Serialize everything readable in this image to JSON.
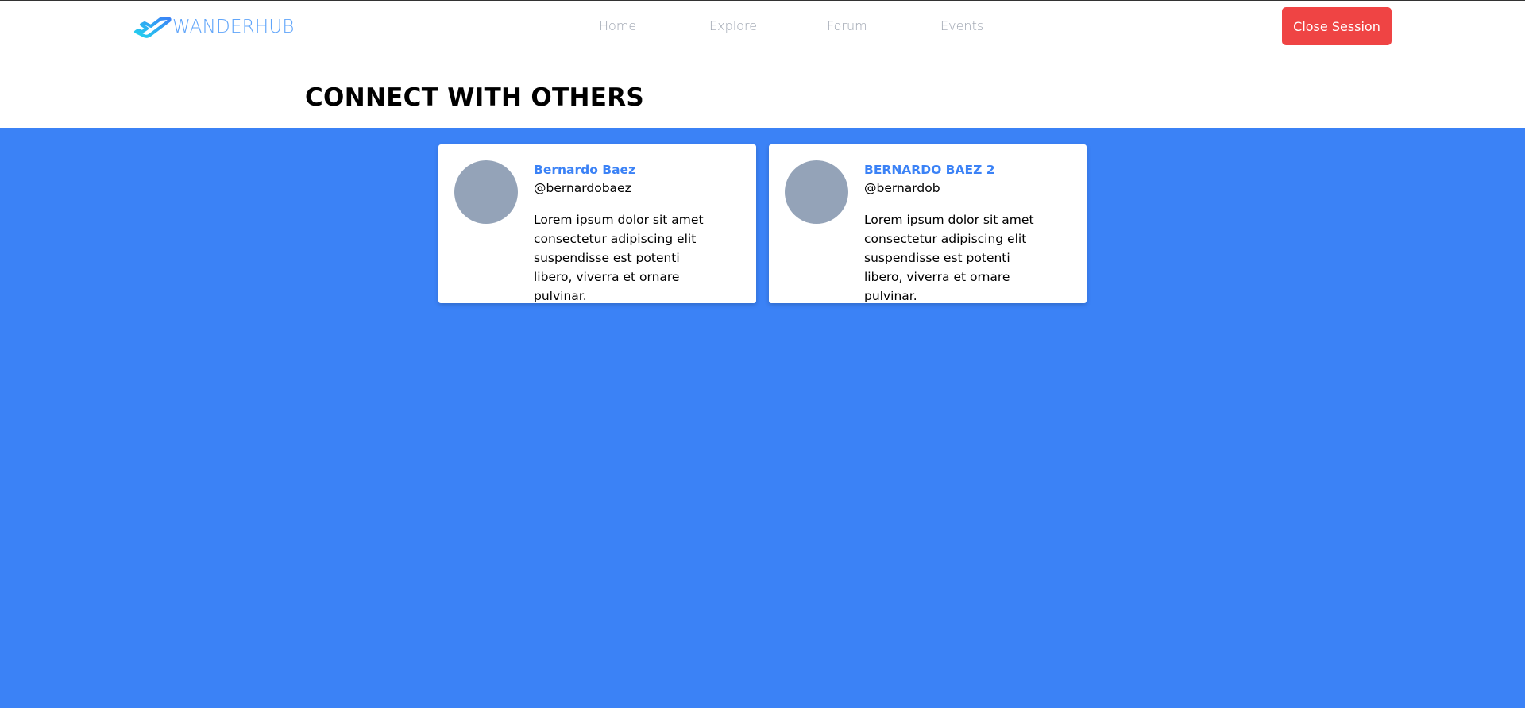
{
  "brand": {
    "name": "WANDERHUB",
    "icon": "plane-icon",
    "color": "#60a5fa"
  },
  "nav": {
    "items": [
      {
        "label": "Home"
      },
      {
        "label": "Explore"
      },
      {
        "label": "Forum"
      },
      {
        "label": "Events"
      }
    ],
    "close_session_label": "Close Session"
  },
  "page": {
    "title": "CONNECT WITH OTHERS"
  },
  "users": [
    {
      "name": "Bernardo Baez",
      "handle": "@bernardobaez",
      "bio": "Lorem ipsum dolor sit amet consectetur adipiscing elit suspendisse est potenti libero, viverra et ornare pulvinar."
    },
    {
      "name": "BERNARDO BAEZ 2",
      "handle": "@bernardob",
      "bio": "Lorem ipsum dolor sit amet consectetur adipiscing elit suspendisse est potenti libero, viverra et ornare pulvinar."
    }
  ],
  "colors": {
    "accent": "#3b82f6",
    "danger": "#ef4444",
    "avatar_placeholder": "#94a3b8"
  }
}
